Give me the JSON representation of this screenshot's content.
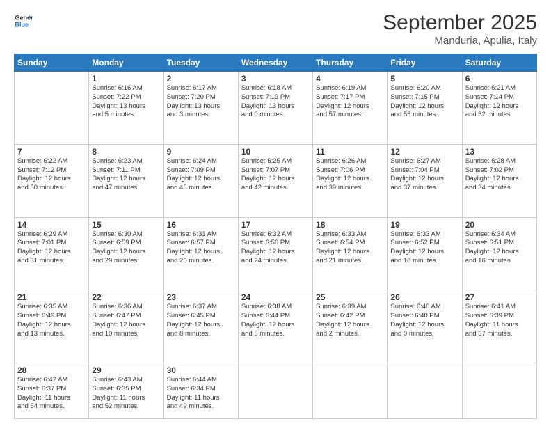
{
  "logo": {
    "text_general": "General",
    "text_blue": "Blue"
  },
  "title": "September 2025",
  "location": "Manduria, Apulia, Italy",
  "days_of_week": [
    "Sunday",
    "Monday",
    "Tuesday",
    "Wednesday",
    "Thursday",
    "Friday",
    "Saturday"
  ],
  "weeks": [
    [
      {
        "day": "",
        "info": ""
      },
      {
        "day": "1",
        "info": "Sunrise: 6:16 AM\nSunset: 7:22 PM\nDaylight: 13 hours\nand 5 minutes."
      },
      {
        "day": "2",
        "info": "Sunrise: 6:17 AM\nSunset: 7:20 PM\nDaylight: 13 hours\nand 3 minutes."
      },
      {
        "day": "3",
        "info": "Sunrise: 6:18 AM\nSunset: 7:19 PM\nDaylight: 13 hours\nand 0 minutes."
      },
      {
        "day": "4",
        "info": "Sunrise: 6:19 AM\nSunset: 7:17 PM\nDaylight: 12 hours\nand 57 minutes."
      },
      {
        "day": "5",
        "info": "Sunrise: 6:20 AM\nSunset: 7:15 PM\nDaylight: 12 hours\nand 55 minutes."
      },
      {
        "day": "6",
        "info": "Sunrise: 6:21 AM\nSunset: 7:14 PM\nDaylight: 12 hours\nand 52 minutes."
      }
    ],
    [
      {
        "day": "7",
        "info": "Sunrise: 6:22 AM\nSunset: 7:12 PM\nDaylight: 12 hours\nand 50 minutes."
      },
      {
        "day": "8",
        "info": "Sunrise: 6:23 AM\nSunset: 7:11 PM\nDaylight: 12 hours\nand 47 minutes."
      },
      {
        "day": "9",
        "info": "Sunrise: 6:24 AM\nSunset: 7:09 PM\nDaylight: 12 hours\nand 45 minutes."
      },
      {
        "day": "10",
        "info": "Sunrise: 6:25 AM\nSunset: 7:07 PM\nDaylight: 12 hours\nand 42 minutes."
      },
      {
        "day": "11",
        "info": "Sunrise: 6:26 AM\nSunset: 7:06 PM\nDaylight: 12 hours\nand 39 minutes."
      },
      {
        "day": "12",
        "info": "Sunrise: 6:27 AM\nSunset: 7:04 PM\nDaylight: 12 hours\nand 37 minutes."
      },
      {
        "day": "13",
        "info": "Sunrise: 6:28 AM\nSunset: 7:02 PM\nDaylight: 12 hours\nand 34 minutes."
      }
    ],
    [
      {
        "day": "14",
        "info": "Sunrise: 6:29 AM\nSunset: 7:01 PM\nDaylight: 12 hours\nand 31 minutes."
      },
      {
        "day": "15",
        "info": "Sunrise: 6:30 AM\nSunset: 6:59 PM\nDaylight: 12 hours\nand 29 minutes."
      },
      {
        "day": "16",
        "info": "Sunrise: 6:31 AM\nSunset: 6:57 PM\nDaylight: 12 hours\nand 26 minutes."
      },
      {
        "day": "17",
        "info": "Sunrise: 6:32 AM\nSunset: 6:56 PM\nDaylight: 12 hours\nand 24 minutes."
      },
      {
        "day": "18",
        "info": "Sunrise: 6:33 AM\nSunset: 6:54 PM\nDaylight: 12 hours\nand 21 minutes."
      },
      {
        "day": "19",
        "info": "Sunrise: 6:33 AM\nSunset: 6:52 PM\nDaylight: 12 hours\nand 18 minutes."
      },
      {
        "day": "20",
        "info": "Sunrise: 6:34 AM\nSunset: 6:51 PM\nDaylight: 12 hours\nand 16 minutes."
      }
    ],
    [
      {
        "day": "21",
        "info": "Sunrise: 6:35 AM\nSunset: 6:49 PM\nDaylight: 12 hours\nand 13 minutes."
      },
      {
        "day": "22",
        "info": "Sunrise: 6:36 AM\nSunset: 6:47 PM\nDaylight: 12 hours\nand 10 minutes."
      },
      {
        "day": "23",
        "info": "Sunrise: 6:37 AM\nSunset: 6:45 PM\nDaylight: 12 hours\nand 8 minutes."
      },
      {
        "day": "24",
        "info": "Sunrise: 6:38 AM\nSunset: 6:44 PM\nDaylight: 12 hours\nand 5 minutes."
      },
      {
        "day": "25",
        "info": "Sunrise: 6:39 AM\nSunset: 6:42 PM\nDaylight: 12 hours\nand 2 minutes."
      },
      {
        "day": "26",
        "info": "Sunrise: 6:40 AM\nSunset: 6:40 PM\nDaylight: 12 hours\nand 0 minutes."
      },
      {
        "day": "27",
        "info": "Sunrise: 6:41 AM\nSunset: 6:39 PM\nDaylight: 11 hours\nand 57 minutes."
      }
    ],
    [
      {
        "day": "28",
        "info": "Sunrise: 6:42 AM\nSunset: 6:37 PM\nDaylight: 11 hours\nand 54 minutes."
      },
      {
        "day": "29",
        "info": "Sunrise: 6:43 AM\nSunset: 6:35 PM\nDaylight: 11 hours\nand 52 minutes."
      },
      {
        "day": "30",
        "info": "Sunrise: 6:44 AM\nSunset: 6:34 PM\nDaylight: 11 hours\nand 49 minutes."
      },
      {
        "day": "",
        "info": ""
      },
      {
        "day": "",
        "info": ""
      },
      {
        "day": "",
        "info": ""
      },
      {
        "day": "",
        "info": ""
      }
    ]
  ]
}
